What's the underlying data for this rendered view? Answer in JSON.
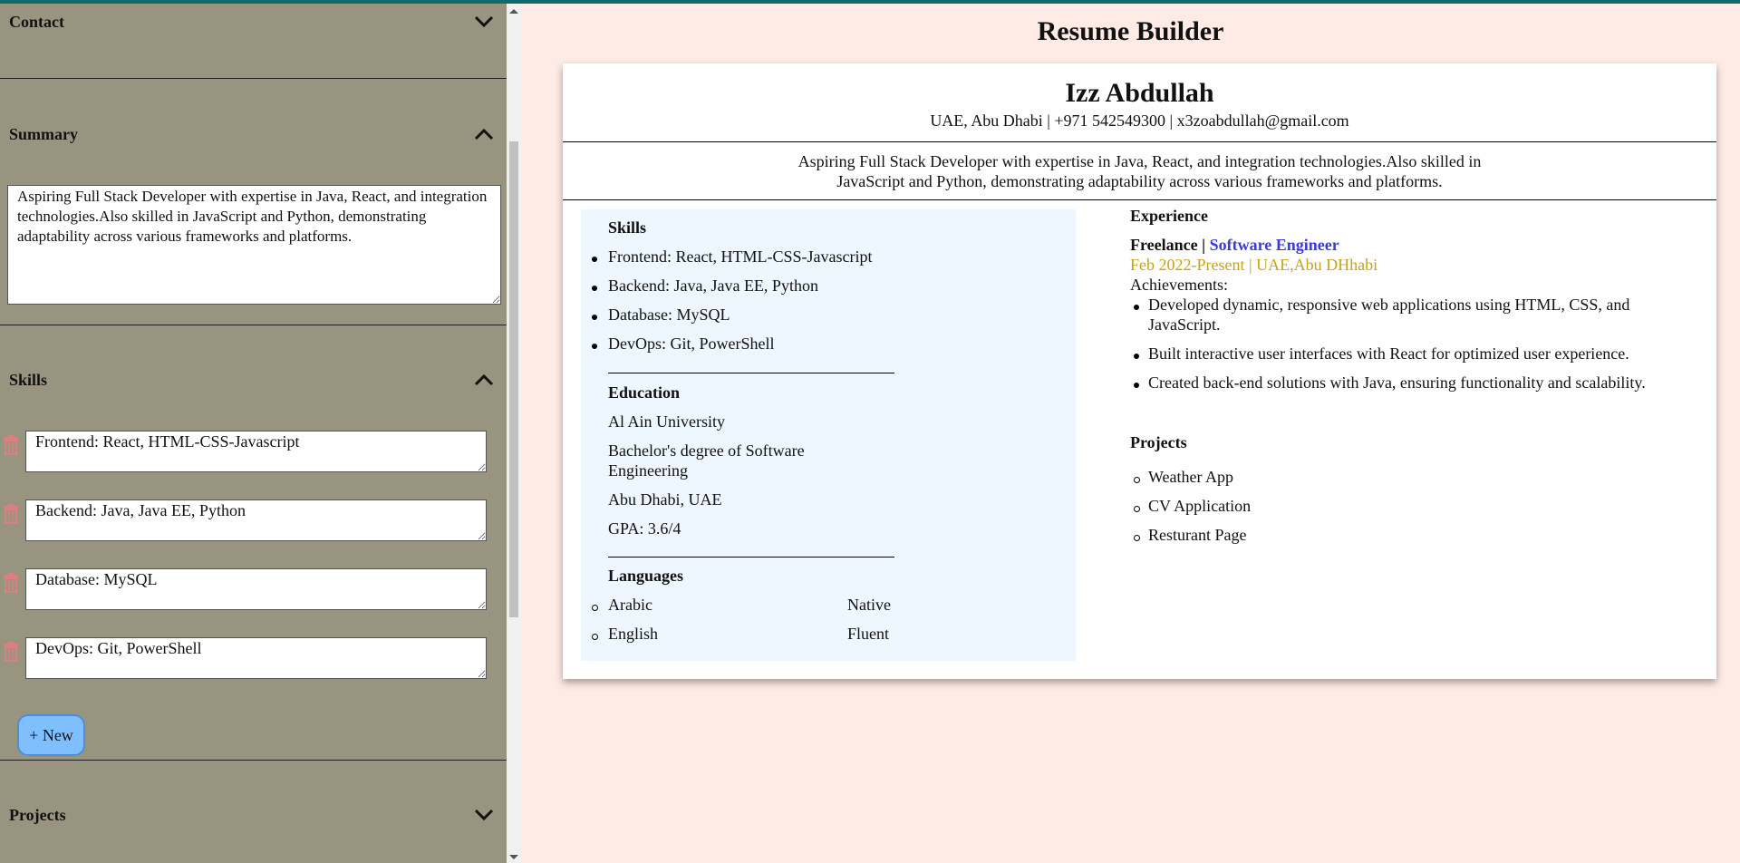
{
  "sidebar": {
    "contact_title": "Contact",
    "summary_title": "Summary",
    "summary_text": "Aspiring Full Stack Developer with expertise in Java, React, and integration technologies.Also skilled in JavaScript and Python, demonstrating adaptability across various frameworks and platforms.",
    "skills_title": "Skills",
    "skills": [
      "Frontend: React, HTML-CSS-Javascript",
      "Backend: Java, Java EE, Python",
      "Database: MySQL",
      "DevOps: Git, PowerShell"
    ],
    "new_button": "+ New",
    "projects_title": "Projects"
  },
  "page_title": "Resume Builder",
  "resume": {
    "name": "Izz Abdullah",
    "contact": "UAE, Abu Dhabi | +971 542549300 | x3zoabdullah@gmail.com",
    "summary_line1": "Aspiring Full Stack Developer with expertise in Java, React, and integration technologies.Also skilled in",
    "summary_line2": "JavaScript and Python, demonstrating adaptability across various frameworks and platforms.",
    "skills_heading": "Skills",
    "skills": [
      "Frontend: React, HTML-CSS-Javascript",
      "Backend: Java, Java EE, Python",
      "Database: MySQL",
      "DevOps: Git, PowerShell"
    ],
    "education_heading": "Education",
    "education": {
      "school": "Al Ain University",
      "degree_line1": "Bachelor's degree of Software",
      "degree_line2": "Engineering",
      "location": "Abu Dhabi, UAE",
      "gpa": "GPA: 3.6/4"
    },
    "languages_heading": "Languages",
    "languages": [
      {
        "name": "Arabic",
        "level": "Native"
      },
      {
        "name": "English",
        "level": "Fluent"
      }
    ],
    "experience_heading": "Experience",
    "experience": {
      "company": "Freelance",
      "separator": "|",
      "role": "Software Engineer",
      "dates": "Feb 2022-Present | UAE,Abu DHhabi",
      "achievements_label": "Achievements:",
      "achievements": [
        "Developed dynamic, responsive web applications using HTML, CSS, and",
        "JavaScript.",
        "Built interactive user interfaces with React for optimized user experience.",
        "Created back-end solutions with Java, ensuring functionality and scalability."
      ]
    },
    "projects_heading": "Projects",
    "projects": [
      "Weather App",
      "CV Application",
      "Resturant Page"
    ]
  },
  "colors": {
    "sidebar_bg": "#999480",
    "page_bg": "#ffebe5",
    "role_color": "#3b3bdb",
    "dates_color": "#c8a21a",
    "new_button_bg": "#80bfff",
    "skills_panel_bg": "#eef6ff"
  }
}
